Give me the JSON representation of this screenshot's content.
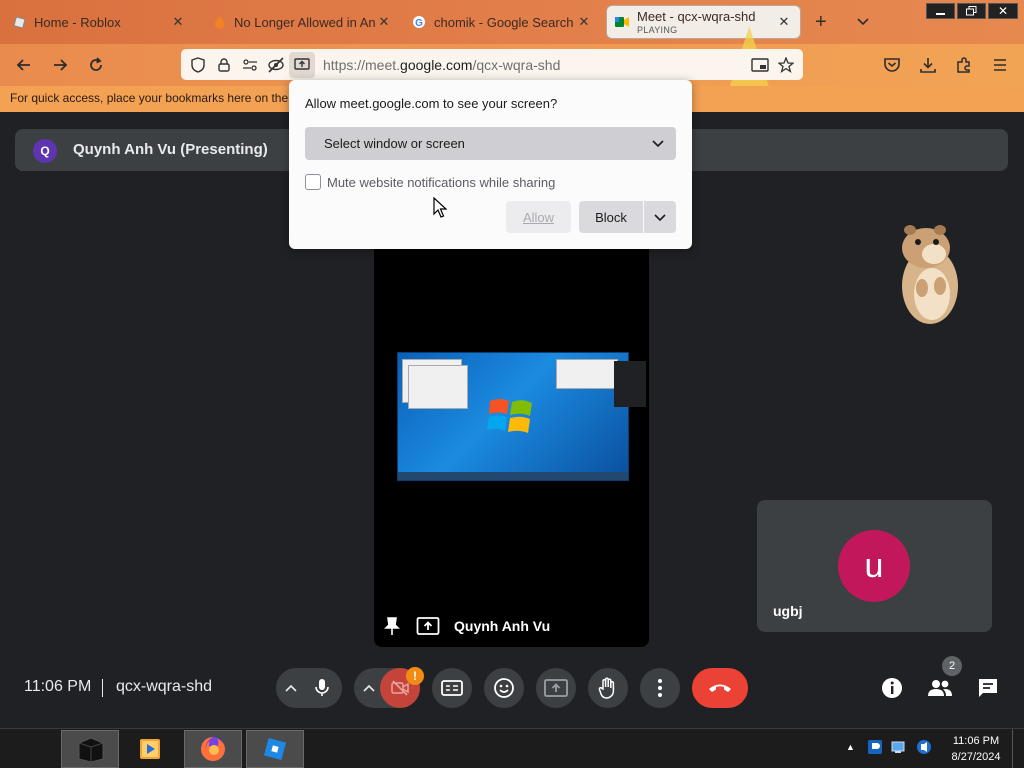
{
  "tabs": [
    {
      "label": "Home - Roblox",
      "icon": "roblox-icon"
    },
    {
      "label": "No Longer Allowed in And",
      "icon": "fire-icon"
    },
    {
      "label": "chomik - Google Search",
      "icon": "google-icon"
    },
    {
      "label": "Meet - qcx-wqra-shd",
      "sub": "PLAYING",
      "icon": "meet-icon",
      "active": true
    }
  ],
  "new_tab": "+",
  "url": {
    "prefix": "https://meet.",
    "host": "google.com",
    "path": "/qcx-wqra-shd"
  },
  "bookmarks_hint": "For quick access, place your bookmarks here on the b",
  "dialog": {
    "title": "Allow meet.google.com to see your screen?",
    "select_value": "Select window or screen",
    "checkbox_label": "Mute website notifications while sharing",
    "allow_label": "Allow",
    "block_label": "Block"
  },
  "presenter": {
    "avatar_letter": "Q",
    "banner_text": "Quynh Anh Vu (Presenting)",
    "stage_name": "Quynh Anh Vu"
  },
  "participant": {
    "letter": "u",
    "name": "ugbj"
  },
  "controls": {
    "time": "11:06 PM",
    "meeting_code": "qcx-wqra-shd",
    "camera_alert": "!",
    "people_count": "2"
  },
  "taskbar": {
    "time": "11:06 PM",
    "date": "8/27/2024"
  },
  "colors": {
    "accent_red": "#ea4335",
    "presenter_avatar": "#5e35b1",
    "participant_avatar": "#c2185b",
    "meet_bg": "#202124"
  }
}
